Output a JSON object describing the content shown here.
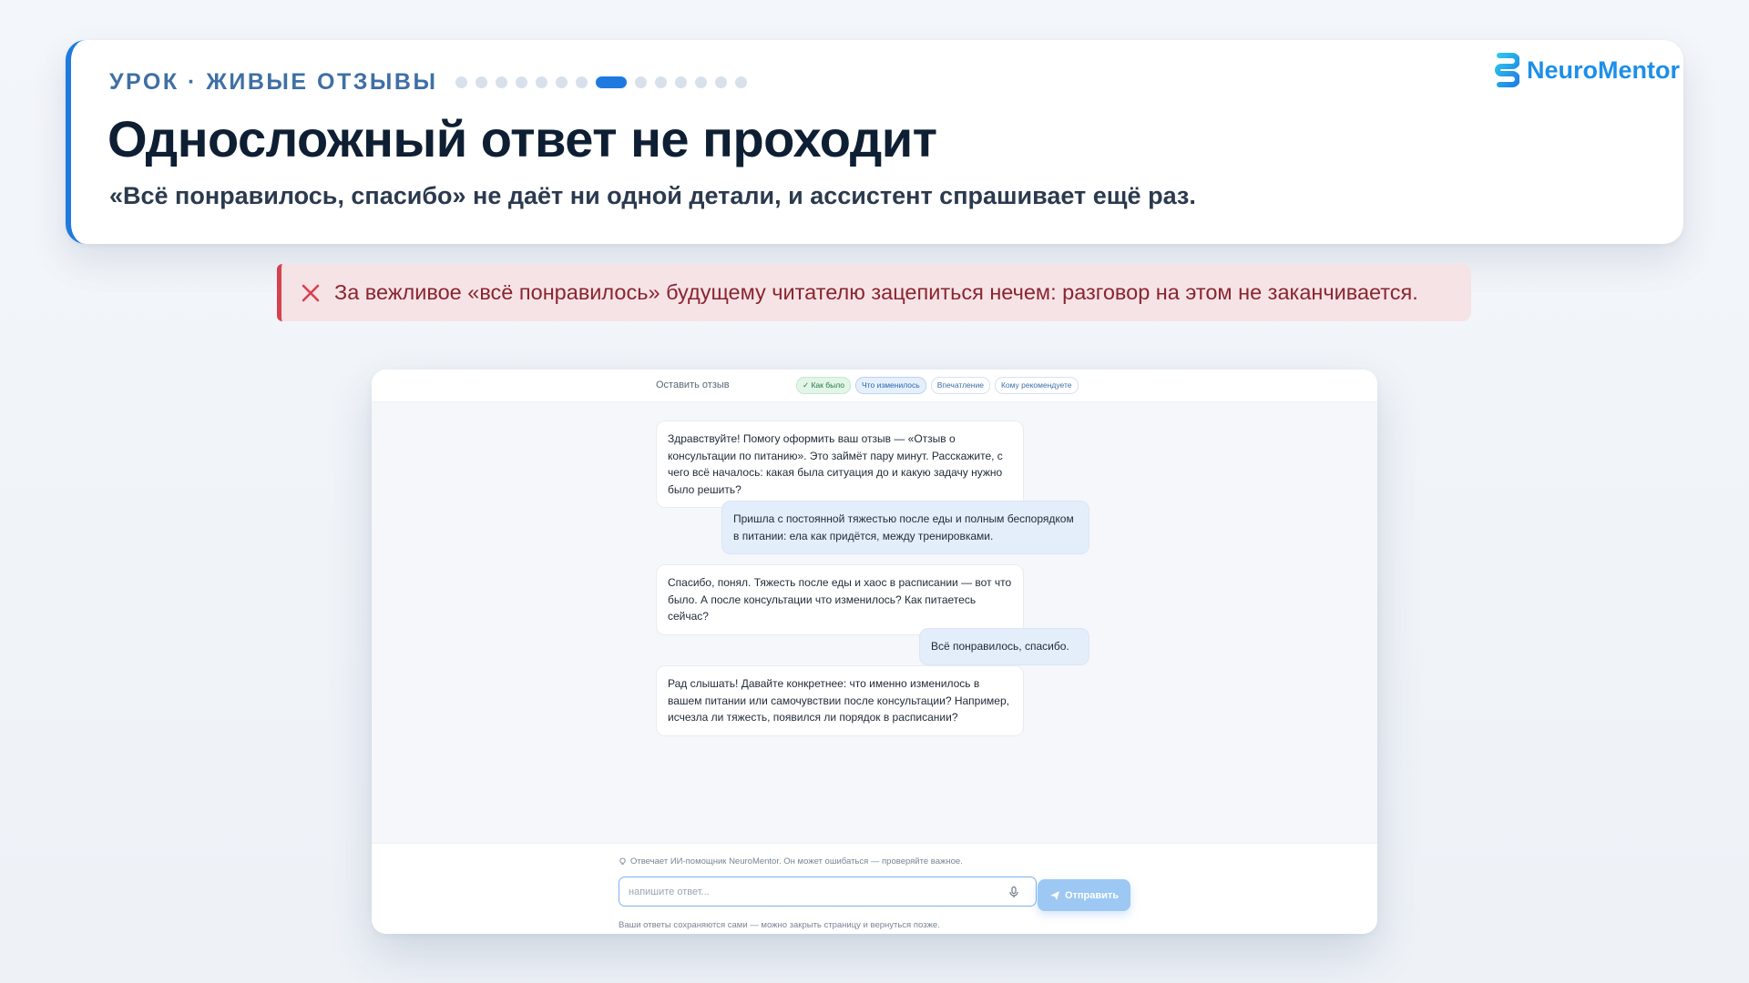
{
  "lesson": {
    "eyebrow": "УРОК · ЖИВЫЕ ОТЗЫВЫ",
    "progress": {
      "total": 14,
      "current": 8
    },
    "title": "Односложный ответ не проходит",
    "subtitle": "«Всё понравилось, спасибо» не даёт ни одной детали, и ассистент спрашивает ещё раз."
  },
  "brand": {
    "name": "NeuroMentor",
    "color": "#1d8fe8"
  },
  "callout": {
    "icon": "close-x-icon",
    "text": "За вежливое «всё понравилось» будущему читателю зацепиться нечем: разговор на этом не заканчивается.",
    "color": "#d7414f"
  },
  "chat": {
    "title": "Оставить отзыв",
    "steps": [
      {
        "label": "✓ Как было",
        "state": "done"
      },
      {
        "label": "Что изменилось",
        "state": "current"
      },
      {
        "label": "Впечатление",
        "state": "pending"
      },
      {
        "label": "Кому рекомендуете",
        "state": "pending"
      }
    ],
    "messages": [
      {
        "role": "bot",
        "text": "Здравствуйте! Помогу оформить ваш отзыв — «Отзыв о консультации по питанию». Это займёт пару минут. Расскажите, с чего всё началось: какая была ситуация до и какую задачу нужно было решить?"
      },
      {
        "role": "user",
        "text": "Пришла с постоянной тяжестью после еды и полным беспорядком в питании: ела как придётся, между тренировками."
      },
      {
        "role": "bot",
        "text": "Спасибо, понял. Тяжесть после еды и хаос в расписании — вот что было. А после консультации что изменилось? Как питаетесь сейчас?"
      },
      {
        "role": "user",
        "text": "Всё понравилось, спасибо."
      },
      {
        "role": "bot",
        "text": "Рад слышать! Давайте конкретнее: что именно изменилось в вашем питании или самочувствии после консультации? Например, исчезла ли тяжесть, появился ли порядок в расписании?"
      }
    ],
    "disclaimer": "Отвечает ИИ-помощник NeuroMentor. Он может ошибаться — проверяйте важное.",
    "input": {
      "value": "",
      "placeholder": "напишите ответ..."
    },
    "send_label": "Отправить",
    "autosave_note": "Ваши ответы сохраняются сами — можно закрыть страницу и вернуться позже."
  },
  "colors": {
    "accent": "#1f7ae0",
    "error": "#d7414f",
    "user_bubble": "#e4eefa"
  }
}
